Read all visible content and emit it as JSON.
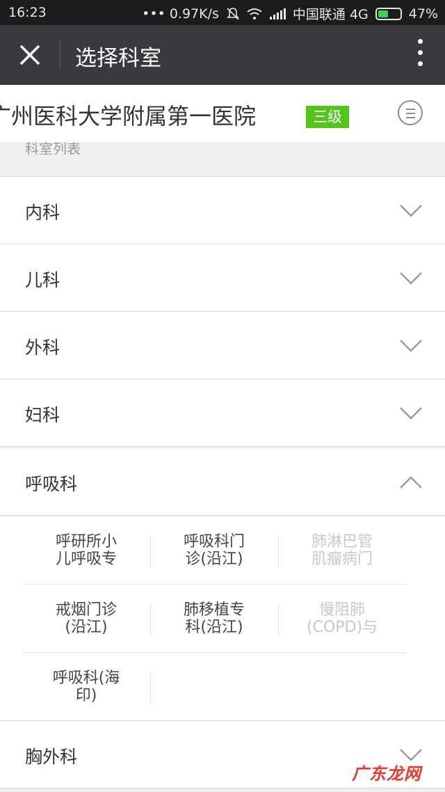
{
  "status": {
    "time": "16:23",
    "speed": "••• 0.97K/s",
    "carrier": "中国联通 4G",
    "battery_text": "47%",
    "battery_level": 0.47
  },
  "header": {
    "title": "选择科室"
  },
  "hospital": {
    "name": "广州医科大学附属第一医院",
    "level": "三级"
  },
  "section_label": "科室列表",
  "departments": [
    {
      "label": "内科"
    },
    {
      "label": "儿科"
    },
    {
      "label": "外科"
    },
    {
      "label": "妇科"
    },
    {
      "label": "呼吸科"
    },
    {
      "label": "胸外科"
    }
  ],
  "sub_departments": [
    {
      "line1": "呼研所小",
      "line2": "儿呼吸专"
    },
    {
      "line1": "呼吸科门",
      "line2": "诊(沿江)"
    },
    {
      "line1": "肺淋巴管",
      "line2": "肌瘤病门"
    },
    {
      "line1": "戒烟门诊",
      "line2": "(沿江)"
    },
    {
      "line1": "肺移植专",
      "line2": "科(沿江)"
    },
    {
      "line1": "慢阻肺",
      "line2": "(COPD)与"
    },
    {
      "line1": "呼吸科(海",
      "line2": "印)"
    }
  ],
  "watermark": "广东龙网",
  "colors": {
    "titlebar": "#393a3e",
    "badge": "#52c41a",
    "watermark": "#e8392f"
  }
}
